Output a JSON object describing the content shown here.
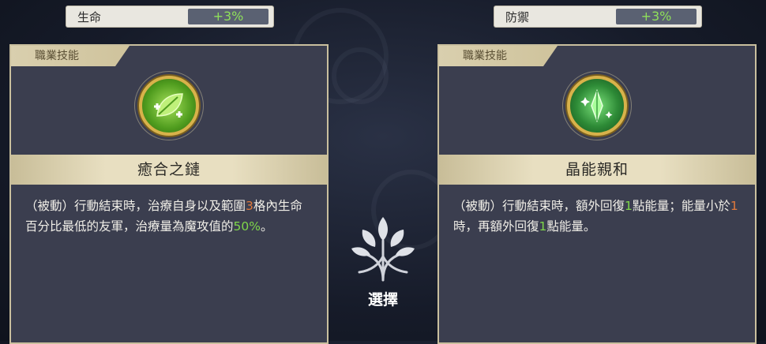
{
  "left": {
    "stat": {
      "label": "生命",
      "value": "+3%"
    },
    "tab": "職業技能",
    "icon": "leaf-heal-icon",
    "name": "癒合之鏈",
    "desc": [
      {
        "t": "（被動）行動結束時，治療自身以及範圍"
      },
      {
        "t": "3",
        "c": "orange"
      },
      {
        "t": "格內生命百分比最低的友軍，治療量為魔攻值的"
      },
      {
        "t": "50%",
        "c": "green"
      },
      {
        "t": "。"
      }
    ]
  },
  "right": {
    "stat": {
      "label": "防禦",
      "value": "+3%"
    },
    "tab": "職業技能",
    "icon": "green-crystal-icon",
    "name": "晶能親和",
    "desc": [
      {
        "t": "（被動）行動結束時，額外回復"
      },
      {
        "t": "1",
        "c": "green"
      },
      {
        "t": "點能量；能量小於"
      },
      {
        "t": "1",
        "c": "orange"
      },
      {
        "t": "時，再額外回復"
      },
      {
        "t": "1",
        "c": "green"
      },
      {
        "t": "點能量。"
      }
    ]
  },
  "select": {
    "label": "選擇",
    "icon": "tree-emblem-icon"
  },
  "colors": {
    "highlight_green": "#7fd74a",
    "highlight_orange": "#e0793c",
    "stat_green": "#8fe05a"
  }
}
